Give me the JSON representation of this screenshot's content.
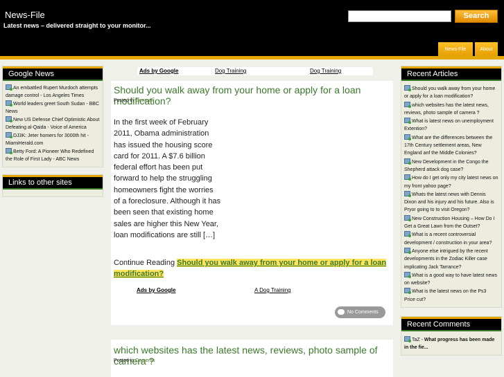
{
  "header": {
    "title": "News-File",
    "tagline": "Latest news – delivered straight to your monitor...",
    "search_button": "Search",
    "nav": [
      "News-File",
      "About"
    ]
  },
  "left_sidebar": {
    "google_news_title": "Google News",
    "google_news_items": [
      "An embattled Rupert Murdoch attempts damage control - Los Angeles Times",
      "World leaders greet South Sudan - BBC News",
      "New US Defense Chief Optimistic About Defeating al-Qaida - Voice of America",
      "DJ3K: Jeter homers for 3000th hit - MiamiHerald.com",
      "Betty Ford: A Pioneer Who Redefined the Role of First Lady - ABC News"
    ],
    "links_title": "Links to other sites"
  },
  "ads_top": {
    "label": "Ads by Google",
    "link1": "Dog Training",
    "link2": "Dog Training"
  },
  "post1": {
    "title": "Should you walk away from your home or apply for a loan modification?",
    "posted_in": "Posted in",
    "category": "General",
    "excerpt": "In the first week of February 2011, Obama administration has issued the housing score card for 2011. A $7.6 billion federal effort has been put forward to help the struggling homeowners fight the worries of a foreclosure. Although it has been seen that existing home sales are higher this New Year, loan modifications are still […]",
    "continue_label": "Continue Reading",
    "continue_link": "Should you walk away from your home or apply for a loan modification?",
    "ads_label": "Ads by Google",
    "ads_link": "A Dog Training",
    "comments": "No Comments"
  },
  "post2": {
    "title": "which websites has the latest news, reviews, photo sample of camera ?",
    "posted_in": "Posted in",
    "category": "Cameras"
  },
  "right_sidebar": {
    "recent_articles_title": "Recent Articles",
    "recent_articles": [
      "Should you walk away from your home or apply for a loan modification?",
      "which websites has the latest news, reviews, photo sample of camera ?",
      "What is latest news on unemployment Extention?",
      "What are the differences between the 17th Century settlement areas, New England anf the Middle Colonies?",
      "New Development in the Congo the Shepherd attack dog case?",
      "How do I get only my city latest news on my front yahoo page?",
      "Whats the latest news with Dennis Dixon and his injury and his future. Also is Pryor going to to visit Oregon?",
      "New Construction Housing – How Do I Get a Great Lawn from the Outset?",
      "What is a recent controversial development / construction in your area?",
      "Anyone else intrigued by the recent developments in the Zodiac Killer case implicating Jack Tarrance?",
      "What is a good way to have latest news on website?",
      "What is the latest news on the Ps3 Price cut?"
    ],
    "recent_comments_title": "Recent Comments",
    "recent_comments": [
      {
        "author": "TaZ",
        "text": "What progress has been made in the fie..."
      }
    ]
  }
}
